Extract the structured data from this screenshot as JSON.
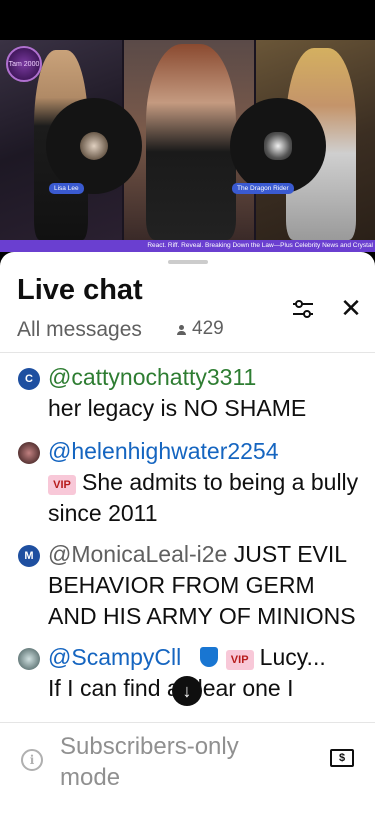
{
  "video": {
    "logo_text": "Tam 2000",
    "guest_left": "Lisa Lee",
    "guest_right": "The Dragon Rider",
    "ticker": "React. Riff. Reveal. Breaking Down the Law—Plus Celebrity News and Crystal"
  },
  "chat": {
    "title": "Live chat",
    "filter_label": "All messages",
    "viewer_count": "429",
    "messages": [
      {
        "avatar_letter": "C",
        "avatar_color": "#1e4fa0",
        "author": "@cattynochatty3311",
        "text": "her legacy is NO SHAME"
      },
      {
        "avatar_letter": "",
        "avatar_color": "#6a4a4a",
        "author": "@helenhighwater2254",
        "badge": "VIP",
        "text": "She admits to being a bully since 2011"
      },
      {
        "avatar_letter": "M",
        "avatar_color": "#1e4fa0",
        "author": "@MonicaLeal-i2e",
        "text": "JUST EVIL BEHAVIOR FROM GERM AND HIS ARMY OF MINIONS"
      },
      {
        "avatar_letter": "",
        "avatar_color": "#8aa0a0",
        "author": "@ScampyC",
        "author_hidden": "ll",
        "badge": "VIP",
        "text": "Lucy...",
        "text2": "If I can find a clear one I"
      }
    ],
    "footer_text": "Subscribers-only mode",
    "accent_color": "#1565c0"
  }
}
